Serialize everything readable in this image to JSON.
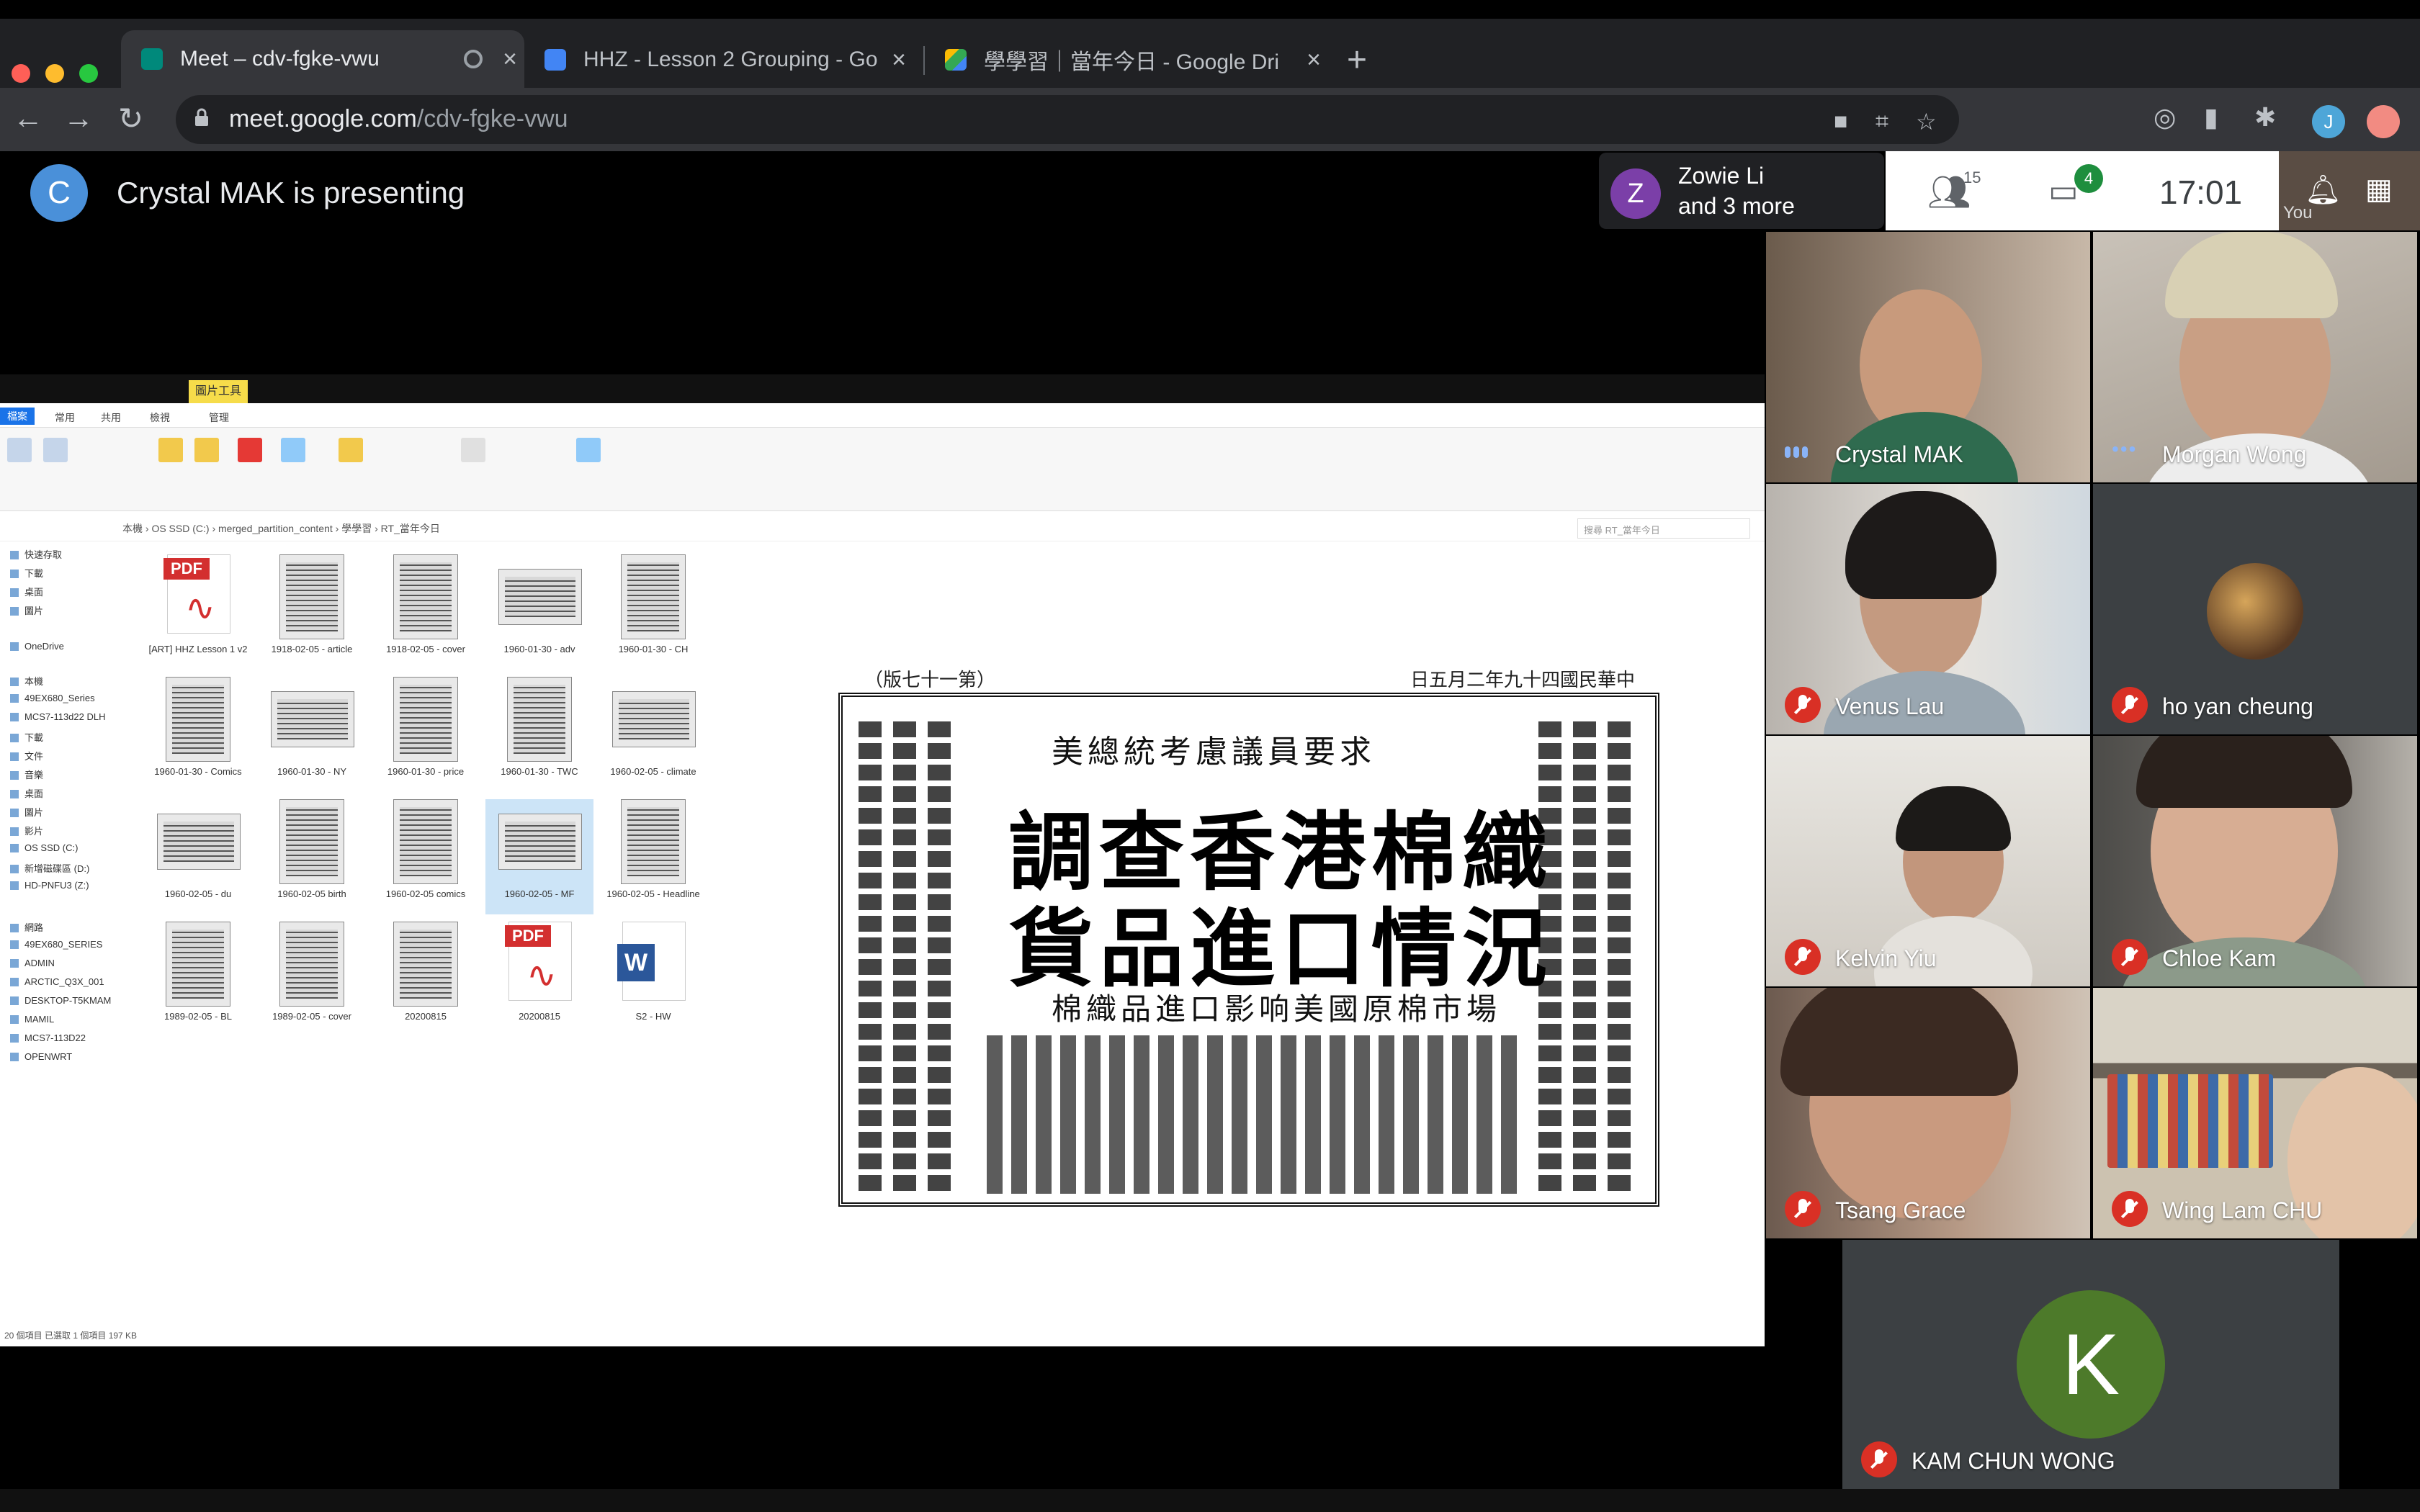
{
  "browser": {
    "tabs": [
      {
        "title": "Meet – cdv-fgke-vwu",
        "active": true
      },
      {
        "title": "HHZ - Lesson 2 Grouping - Go"
      },
      {
        "title": "學學習｜當年今日 - Google Dri"
      }
    ],
    "url_host": "meet.google.com",
    "url_path": "/cdv-fgke-vwu",
    "profile_initial": "J"
  },
  "meet": {
    "presenter_initial": "C",
    "presenting_text": "Crystal MAK is presenting",
    "pinned_initial": "Z",
    "pinned_name": "Zowie Li",
    "pinned_more": "and 3 more",
    "people_count": "15",
    "chat_count": "4",
    "clock": "17:01",
    "self_label": "You"
  },
  "explorer": {
    "ribbon_highlight": "圖片工具",
    "path": "本機 › OS SSD (C:) › merged_partition_content › 學學習 › RT_當年今日",
    "search_placeholder": "搜尋 RT_當年今日",
    "nav_items": [
      "快速存取",
      "下載",
      "桌面",
      "圖片",
      "OneDrive",
      "本機",
      "49EX680_Series",
      "MCS7-113d22 DLH",
      "下載",
      "文件",
      "音樂",
      "桌面",
      "圖片",
      "影片",
      "OS SSD (C:)",
      "新增磁碟區 (D:)",
      "HD-PNFU3 (Z:)",
      "網路",
      "49EX680_SERIES",
      "ADMIN",
      "ARCTIC_Q3X_001",
      "DESKTOP-T5KMAM",
      "MAMIL",
      "MCS7-113D22",
      "OPENWRT"
    ],
    "files": [
      {
        "label": "[ART] HHZ Lesson 1 v2",
        "kind": "pdf"
      },
      {
        "label": "1918-02-05 - article",
        "kind": "doc-img"
      },
      {
        "label": "1918-02-05 - cover",
        "kind": "doc-img"
      },
      {
        "label": "1960-01-30 - adv",
        "kind": "wide"
      },
      {
        "label": "1960-01-30 - CH",
        "kind": "doc-img"
      },
      {
        "label": "1960-01-30 - Comics",
        "kind": "doc-img"
      },
      {
        "label": "1960-01-30 - NY",
        "kind": "wide"
      },
      {
        "label": "1960-01-30 - price",
        "kind": "doc-img"
      },
      {
        "label": "1960-01-30 - TWC",
        "kind": "doc-img"
      },
      {
        "label": "1960-02-05 - climate",
        "kind": "wide"
      },
      {
        "label": "1960-02-05 - du",
        "kind": "wide"
      },
      {
        "label": "1960-02-05 birth",
        "kind": "doc-img"
      },
      {
        "label": "1960-02-05 comics",
        "kind": "doc-img"
      },
      {
        "label": "1960-02-05 - MF",
        "kind": "wide",
        "selected": true
      },
      {
        "label": "1960-02-05 - Headline",
        "kind": "doc-img"
      },
      {
        "label": "1989-02-05 - BL",
        "kind": "doc-img"
      },
      {
        "label": "1989-02-05 - cover",
        "kind": "doc-img"
      },
      {
        "label": "20200815",
        "kind": "doc-img"
      },
      {
        "label": "20200815",
        "kind": "pdf"
      },
      {
        "label": "S2 - HW",
        "kind": "word"
      }
    ],
    "status": "20 個項目   已選取 1 個項目  197 KB",
    "pdf_tag": "PDF",
    "word_tag": "W"
  },
  "newspaper": {
    "subhead": "美總統考慮議員要求",
    "headline_1": "調查香港棉織",
    "headline_2": "貨品進口情況",
    "deck": "棉織品進口影响美國原棉市場",
    "top_left": "（版七十一第）",
    "top_right": "日五月二年九十四國民華中"
  },
  "participants": [
    {
      "name": "Crystal MAK",
      "state": "speaking"
    },
    {
      "name": "Morgan Wong",
      "state": "dots"
    },
    {
      "name": "Venus Lau",
      "state": "muted"
    },
    {
      "name": "ho yan cheung",
      "state": "muted"
    },
    {
      "name": "Kelvin Yiu",
      "state": "muted"
    },
    {
      "name": "Chloe Kam",
      "state": "muted"
    },
    {
      "name": "Tsang Grace",
      "state": "muted"
    },
    {
      "name": "Wing Lam CHU",
      "state": "muted"
    },
    {
      "name": "KAM CHUN WONG",
      "state": "muted",
      "initial": "K"
    }
  ],
  "colors": {
    "meet_accent": "#1e8e3e",
    "mute_red": "#d93025",
    "avatar_blue": "#4a90d9",
    "avatar_purple": "#7b3fa8",
    "avatar_green": "#4d7a2a"
  },
  "icons": [
    "back-icon",
    "forward-icon",
    "reload-icon",
    "lock-icon",
    "camera-icon",
    "translate-icon",
    "star-icon",
    "extension-icon",
    "people-icon",
    "chat-icon",
    "bell-icon",
    "grid-icon",
    "mic-off-icon"
  ]
}
